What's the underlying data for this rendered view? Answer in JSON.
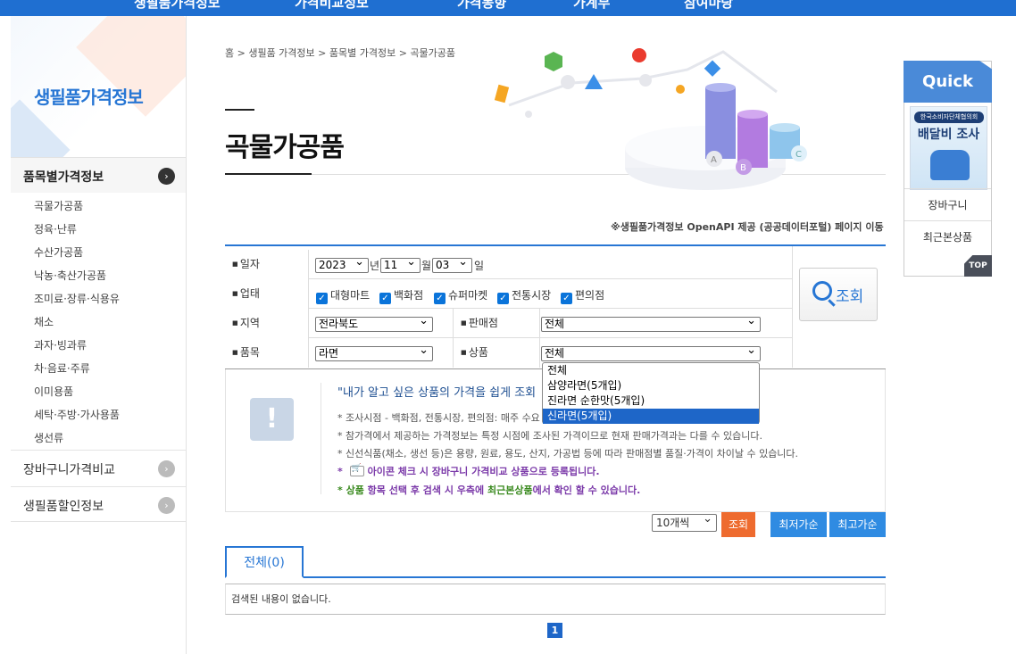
{
  "top_nav": [
    "생필품가격정보",
    "가격비교정보",
    "가격동향",
    "가계부",
    "참여마당"
  ],
  "sidebar": {
    "title": "생필품가격정보",
    "sections": [
      {
        "label": "품목별가격정보",
        "active": true
      },
      {
        "label": "장바구니가격비교",
        "active": false
      },
      {
        "label": "생필품할인정보",
        "active": false
      }
    ],
    "sub_items": [
      "곡물가공품",
      "정육·난류",
      "수산가공품",
      "낙농·축산가공품",
      "조미료·장류·식용유",
      "채소",
      "과자·빙과류",
      "차·음료·주류",
      "이미용품",
      "세탁·주방·가사용품",
      "생선류"
    ]
  },
  "breadcrumb": "홈 > 생필품 가격정보 > 품목별 가격정보 > 곡물가공품",
  "page_title": "곡물가공품",
  "openapi_note": "※생필품가격정보 OpenAPI 제공 (공공데이터포털) 페이지 이동",
  "filters": {
    "date_label": "일자",
    "year": "2023",
    "year_unit": "년",
    "month": "11",
    "month_unit": "월",
    "day": "03",
    "day_unit": "일",
    "biz_label": "업태",
    "biz_types": [
      "대형마트",
      "백화점",
      "슈퍼마켓",
      "전통시장",
      "편의점"
    ],
    "region_label": "지역",
    "region": "전라북도",
    "store_label": "판매점",
    "store": "전체",
    "item_label": "품목",
    "item": "라면",
    "product_label": "상품",
    "product": "전체",
    "product_options": [
      "전체",
      "삼양라면(5개입)",
      "진라면 순한맛(5개입)",
      "신라면(5개입)"
    ],
    "product_highlight_index": 3,
    "search_label": "조회"
  },
  "notice": {
    "headline": "\"내가 알고 싶은 상품의 가격을 쉽게 조회",
    "lines": [
      "조사시점 - 백화점, 전통시장, 편의점: 매주 수요",
      "참가격에서 제공하는 가격정보는 특정 시점에 조사된 가격이므로 현재 판매가격과는 다를 수 있습니다.",
      "신선식품(채소, 생선 등)은 용량, 원료, 용도, 산지, 가공법 등에 따라 판매점별 품질·가격이 차이날 수 있습니다."
    ],
    "cart_line": "아이콘 체크 시 장바구니 가격비교 상품으로 등록됩니다.",
    "last_line_a": "상품",
    "last_line_b": " 항목 선택 후 검색 시 우측에 ",
    "last_line_c": "최근본상품",
    "last_line_d": "에서 확인 할 수 있습니다."
  },
  "controls": {
    "per_page": "10개씩",
    "query_btn": "조회",
    "lowest_btn": "최저가순",
    "highest_btn": "최고가순"
  },
  "tabs": [
    {
      "label": "전체(0)"
    }
  ],
  "result_text": "검색된 내용이 없습니다.",
  "pagination": {
    "current": "1"
  },
  "quick": {
    "title": "Quick",
    "banner_org": "한국소비자단체협의회",
    "banner_title": "배달비 조사",
    "items": [
      "장바구니",
      "최근본상품"
    ],
    "top_label": "TOP"
  },
  "colors": {
    "primary": "#2776d4",
    "accent_orange": "#ee6b2f",
    "sort_blue": "#2f8be2"
  }
}
